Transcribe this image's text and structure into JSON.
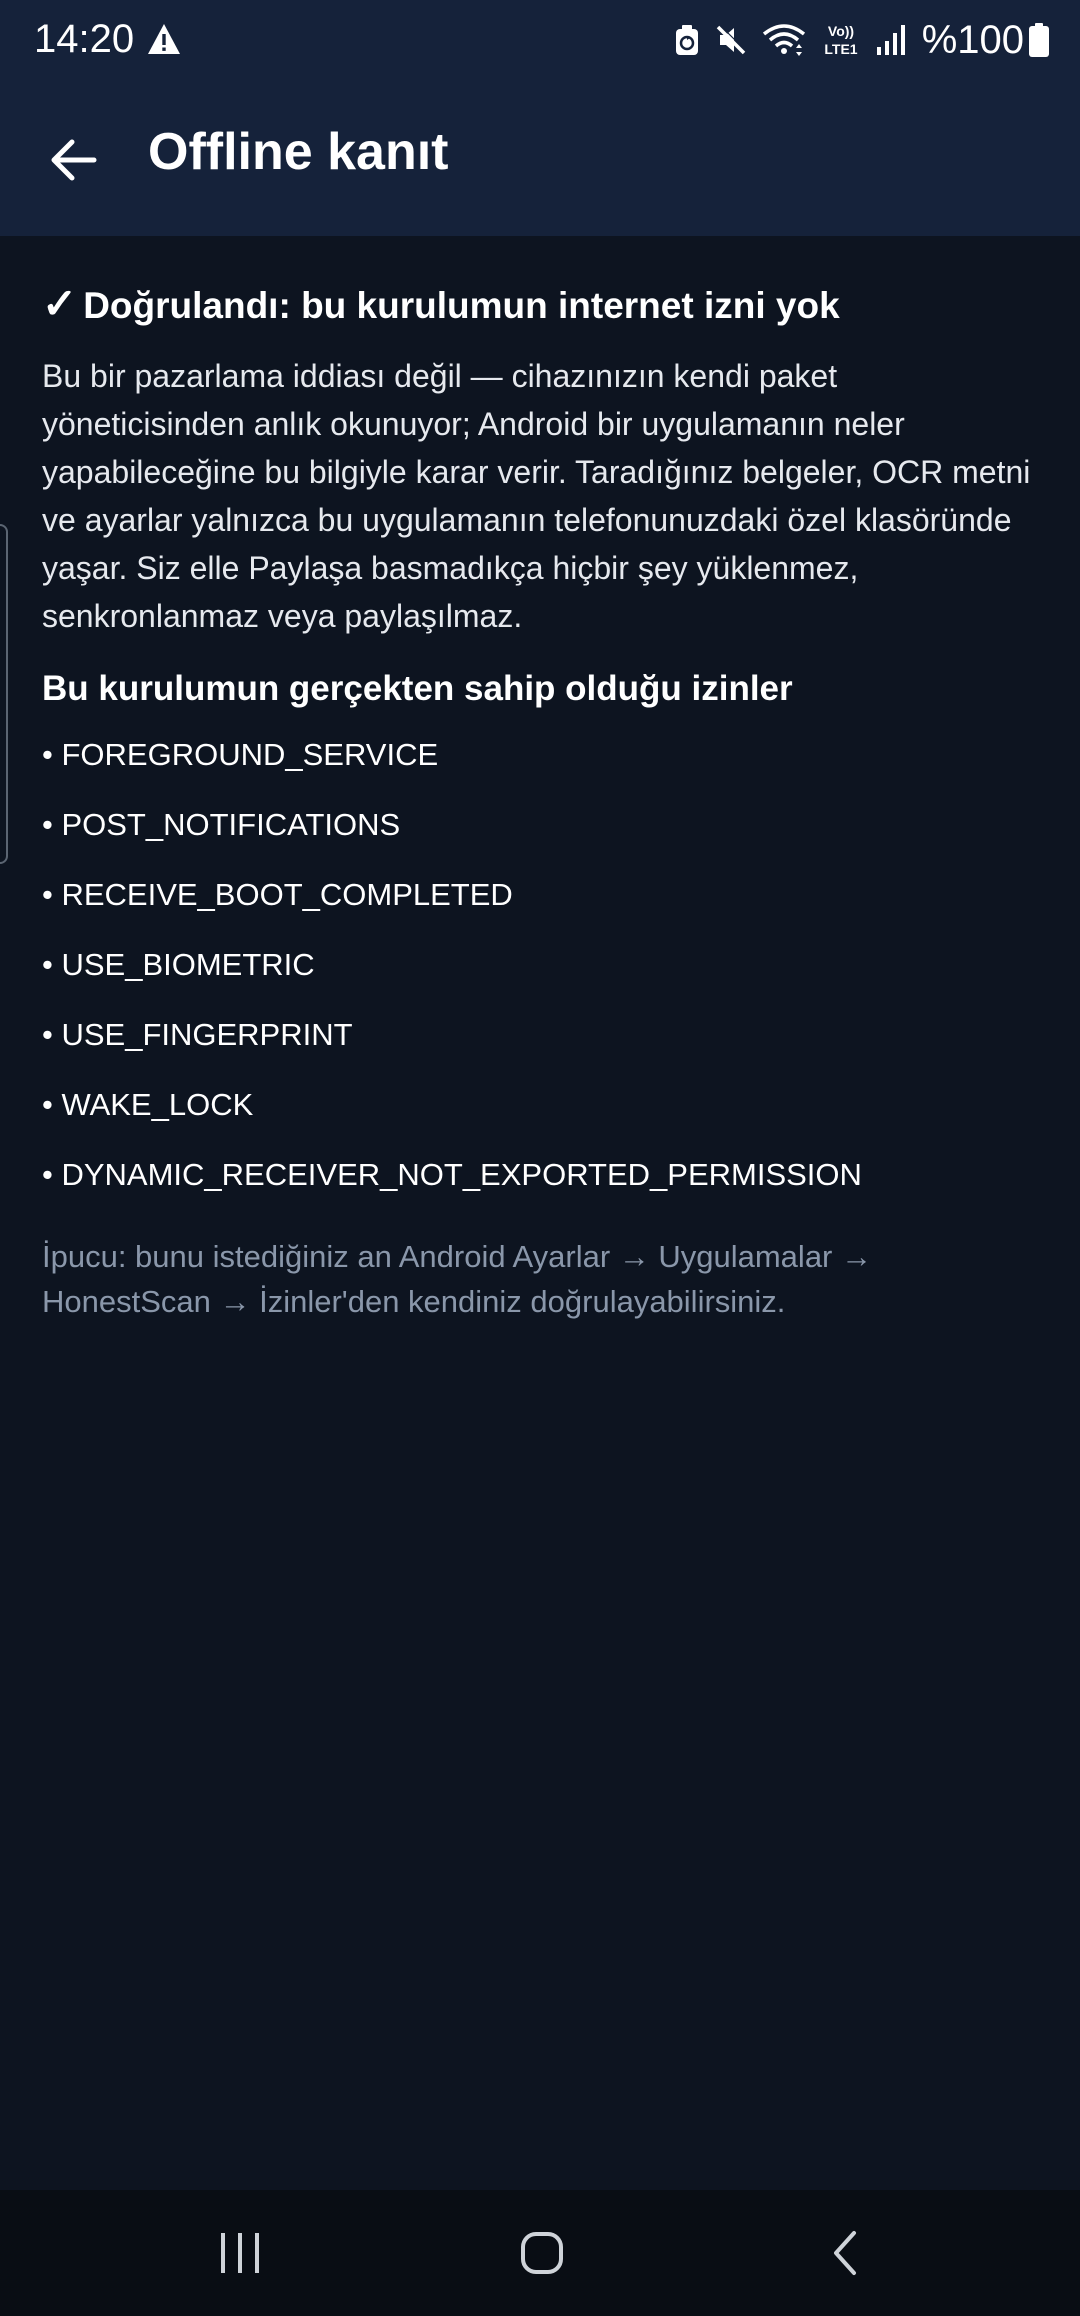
{
  "status_bar": {
    "time": "14:20",
    "battery_text": "%100",
    "lte_label_top": "Vo))",
    "lte_label_bottom": "LTE1",
    "icons": [
      "warning-icon",
      "recycle-icon",
      "mute-icon",
      "wifi-icon",
      "lte-icon",
      "signal-icon",
      "battery-icon"
    ]
  },
  "app_bar": {
    "title": "Offline kanıt",
    "back_icon": "arrow-left-icon"
  },
  "content": {
    "verified_check": "✓",
    "verified_title": "Doğrulandı: bu kurulumun internet izni yok",
    "body": "Bu bir pazarlama iddiası değil — cihazınızın kendi paket yöneticisinden anlık okunuyor; Android bir uygulamanın neler yapabileceğine bu bilgiyle karar verir. Taradığınız belgeler, OCR metni ve ayarlar yalnızca bu uygulamanın telefonunuzdaki özel klasöründe yaşar. Siz elle Paylaşa basmadıkça hiçbir şey yüklenmez, senkronlanmaz veya paylaşılmaz.",
    "permissions_title": "Bu kurulumun gerçekten sahip olduğu izinler",
    "permissions": [
      "• FOREGROUND_SERVICE",
      "• POST_NOTIFICATIONS",
      "• RECEIVE_BOOT_COMPLETED",
      "• USE_BIOMETRIC",
      "• USE_FINGERPRINT",
      "• WAKE_LOCK",
      "• DYNAMIC_RECEIVER_NOT_EXPORTED_PERMISSION"
    ],
    "tip": "İpucu: bunu istediğiniz an Android Ayarlar → Uygulamalar → HonestScan → İzinler'den kendiniz doğrulayabilirsiniz."
  },
  "nav_bar": {
    "icons": [
      "recent-apps-icon",
      "home-icon",
      "back-icon"
    ]
  },
  "colors": {
    "header_bg": "#15223a",
    "page_bg": "#0d1420",
    "nav_bg": "#090d14",
    "text_primary": "#ffffff",
    "text_muted": "#8a97aa"
  }
}
